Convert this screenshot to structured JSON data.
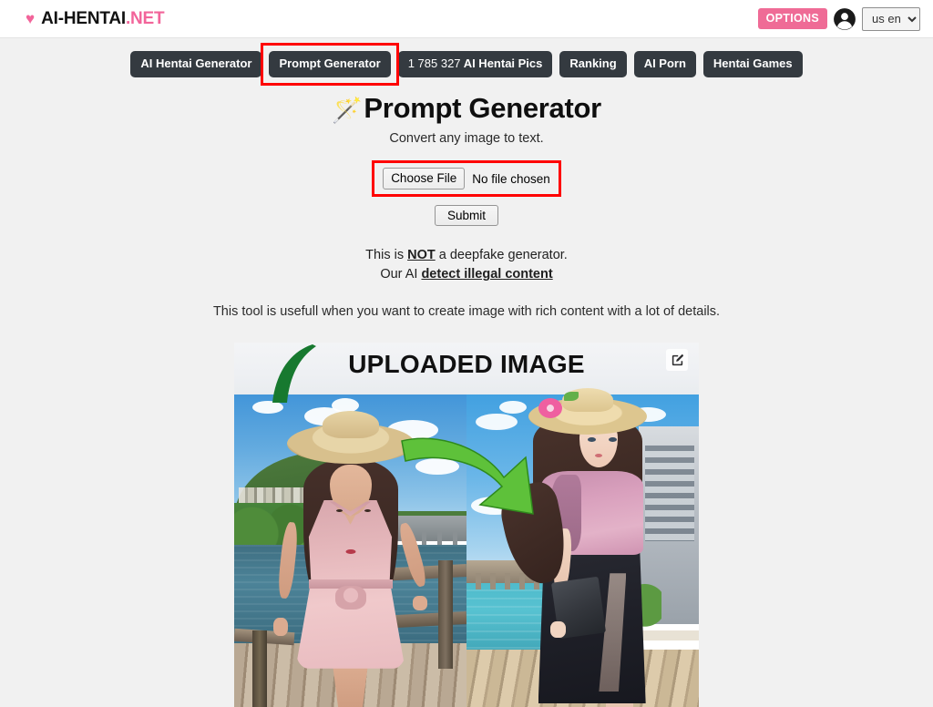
{
  "header": {
    "brand_heart": "♥",
    "brand_name": "AI-HENTAI",
    "brand_tld": ".NET",
    "options_label": "OPTIONS",
    "account_icon": "account-circle-icon",
    "language_selected": "us en",
    "language_options": [
      "us en"
    ]
  },
  "nav": {
    "items": [
      {
        "label": "AI Hentai Generator",
        "highlighted": false
      },
      {
        "label": "Prompt Generator",
        "highlighted": true
      },
      {
        "label": "1 785 327 AI Hentai Pics",
        "count": "1 785 327",
        "rest": "AI Hentai Pics",
        "highlighted": false
      },
      {
        "label": "Ranking",
        "highlighted": false
      },
      {
        "label": "AI Porn",
        "highlighted": false
      },
      {
        "label": "Hentai Games",
        "highlighted": false
      }
    ]
  },
  "main": {
    "title_emoji": "🪄",
    "title": "Prompt Generator",
    "subtitle": "Convert any image to text.",
    "file_button_label": "Choose File",
    "file_status": "No file chosen",
    "submit_label": "Submit",
    "notice_line1_pre": "This is ",
    "notice_line1_strong": "NOT",
    "notice_line1_post": " a deepfake generator.",
    "notice_line2_pre": "Our AI ",
    "notice_line2_link": "detect illegal content",
    "tool_description": "This tool is usefull when you want to create image with rich content with a lot of details."
  },
  "example_image": {
    "banner_text": "UPLOADED IMAGE",
    "edit_icon": "pencil-square-icon",
    "left_photo_alt": "Photo of woman in straw hat and pink dress on a riverside boardwalk",
    "right_photo_alt": "Anime rendering of woman in straw hat with flower, pink top and black skirt"
  },
  "colors": {
    "accent_pink": "#ef6b96",
    "nav_dark": "#343a40",
    "highlight_red": "#ff0000",
    "page_background": "#f1f1f1",
    "header_background": "#ffffff"
  }
}
